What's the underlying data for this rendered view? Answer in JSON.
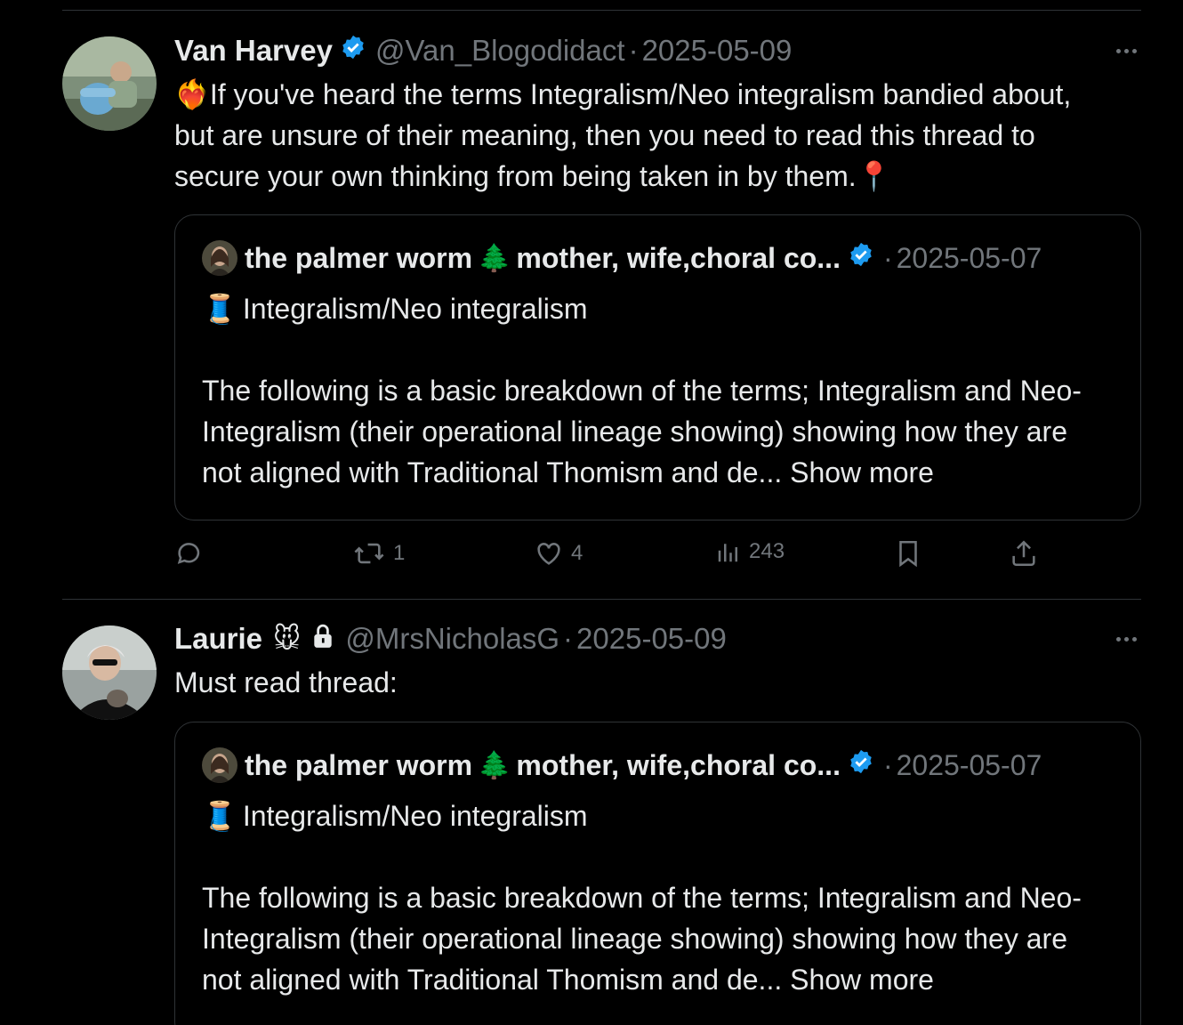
{
  "tweets": [
    {
      "name": "Van Harvey",
      "handle": "@Van_Blogodidact",
      "separator": "·",
      "date": "2025-05-09",
      "text": "❤️‍🔥If you've heard the terms Integralism/Neo integralism bandied about, but are unsure of their meaning, then you need to read this thread to secure your own thinking from being taken in by them.📍",
      "quote": {
        "name": "the palmer worm",
        "emoji_tree": "🌲",
        "name_rest": "mother, wife,choral co...",
        "separator": "·",
        "date": "2025-05-07",
        "thread_emoji": "🧵",
        "headline": "Integralism/Neo integralism",
        "text": "The following is a basic breakdown of the terms; Integralism and Neo-Integralism (their operational lineage showing) showing how they are not aligned with Traditional Thomism and de...",
        "show_more": "Show more"
      },
      "actions": {
        "retweets": "1",
        "likes": "4",
        "views": "243"
      }
    },
    {
      "name": "Laurie",
      "name_emoji": "🐭",
      "handle": "@MrsNicholasG",
      "separator": "·",
      "date": "2025-05-09",
      "text": "Must read thread:",
      "quote": {
        "name": "the palmer worm",
        "emoji_tree": "🌲",
        "name_rest": "mother, wife,choral co...",
        "separator": "·",
        "date": "2025-05-07",
        "thread_emoji": "🧵",
        "headline": "Integralism/Neo integralism",
        "text": "The following is a basic breakdown of the terms; Integralism and Neo-Integralism (their operational lineage showing) showing how they are not aligned with Traditional Thomism and de...",
        "show_more": "Show more"
      }
    }
  ],
  "colors": {
    "background": "#000000",
    "text": "#e7e9ea",
    "muted": "#71767b",
    "border": "#2f3336",
    "verified": "#1d9bf0"
  }
}
